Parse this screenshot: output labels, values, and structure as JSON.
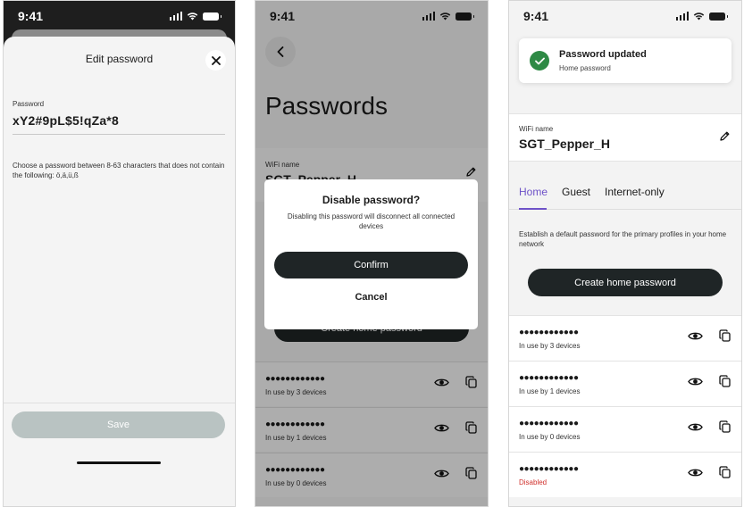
{
  "status_time": "9:41",
  "edit_sheet": {
    "title": "Edit password",
    "field_label": "Password",
    "field_value": "xY2#9pL$5!qZa*8",
    "hint": "Choose a password between 8-63 characters that does not contain the following: ö,ä,ü,ß",
    "save_label": "Save"
  },
  "passwords_page": {
    "title": "Passwords",
    "wifi_label": "WiFi name",
    "wifi_name": "SGT_Pepper_H",
    "create_label": "Create home password",
    "dialog": {
      "title": "Disable password?",
      "message": "Disabling this password will disconnect all connected devices",
      "confirm_label": "Confirm",
      "cancel_label": "Cancel"
    },
    "rows": [
      {
        "masked": "●●●●●●●●●●●●",
        "status": "In use by 3 devices"
      },
      {
        "masked": "●●●●●●●●●●●●",
        "status": "In use by 1 devices"
      },
      {
        "masked": "●●●●●●●●●●●●",
        "status": "In use by 0 devices"
      }
    ]
  },
  "updated_page": {
    "toast": {
      "title": "Password updated",
      "subtitle": "Home password"
    },
    "wifi_label": "WiFi name",
    "wifi_name": "SGT_Pepper_H",
    "tabs": [
      {
        "label": "Home",
        "active": true
      },
      {
        "label": "Guest",
        "active": false
      },
      {
        "label": "Internet-only",
        "active": false
      }
    ],
    "description": "Establish a default password for the primary profiles in your home network",
    "create_label": "Create home password",
    "rows": [
      {
        "masked": "●●●●●●●●●●●●",
        "status": "In use by 3 devices",
        "disabled": false
      },
      {
        "masked": "●●●●●●●●●●●●",
        "status": "In use by 1 devices",
        "disabled": false
      },
      {
        "masked": "●●●●●●●●●●●●",
        "status": "In use by 0 devices",
        "disabled": false
      },
      {
        "masked": "●●●●●●●●●●●●",
        "status": "Disabled",
        "disabled": true
      }
    ]
  },
  "colors": {
    "accent": "#6e52c8",
    "success": "#2e8a45",
    "danger": "#d0302c",
    "primary_button": "#1f2526",
    "disabled_button": "#b9c3c2"
  }
}
